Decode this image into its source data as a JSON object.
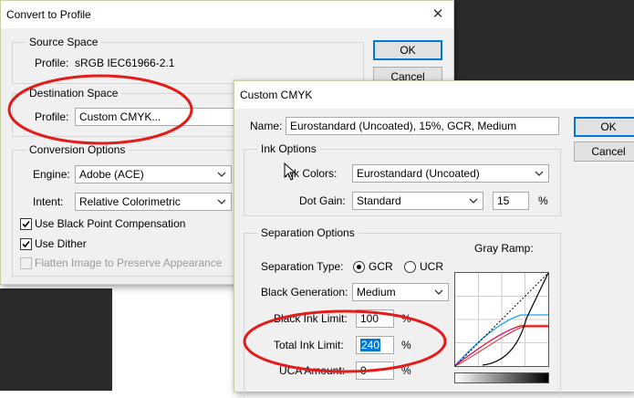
{
  "convert": {
    "title": "Convert to Profile",
    "close": "✕",
    "source_space": {
      "legend": "Source Space",
      "profile_label": "Profile:",
      "profile_value": "sRGB IEC61966-2.1"
    },
    "destination_space": {
      "legend": "Destination Space",
      "profile_label": "Profile:",
      "profile_value": "Custom CMYK..."
    },
    "conversion_options": {
      "legend": "Conversion Options",
      "engine_label": "Engine:",
      "engine_value": "Adobe (ACE)",
      "intent_label": "Intent:",
      "intent_value": "Relative Colorimetric",
      "black_point": {
        "label": "Use Black Point Compensation",
        "checked": true
      },
      "dither": {
        "label": "Use Dither",
        "checked": true
      },
      "flatten": {
        "label": "Flatten Image to Preserve Appearance",
        "checked": false,
        "disabled": true
      }
    },
    "ok": "OK",
    "cancel": "Cancel"
  },
  "custom_cmyk": {
    "title": "Custom CMYK",
    "name_label": "Name:",
    "name_value": "Eurostandard (Uncoated), 15%, GCR, Medium",
    "ok": "OK",
    "cancel": "Cancel",
    "ink_options": {
      "legend": "Ink Options",
      "ink_colors_label": "Ink Colors:",
      "ink_colors_value": "Eurostandard (Uncoated)",
      "dot_gain_label": "Dot Gain:",
      "dot_gain_mode": "Standard",
      "dot_gain_value": "15",
      "dot_gain_unit": "%"
    },
    "separation_options": {
      "legend": "Separation Options",
      "type_label": "Separation Type:",
      "gcr": "GCR",
      "ucr": "UCR",
      "selected": "GCR",
      "black_generation_label": "Black Generation:",
      "black_generation_value": "Medium",
      "black_ink_limit_label": "Black Ink Limit:",
      "black_ink_limit_value": "100",
      "total_ink_limit_label": "Total Ink Limit:",
      "total_ink_limit_value": "240",
      "uca_amount_label": "UCA Amount:",
      "uca_amount_value": "0",
      "percent": "%",
      "gray_ramp_label": "Gray Ramp:"
    }
  },
  "colors": {
    "annotation": "#e41b1b",
    "accent": "#0078d7",
    "cyan": "#1aa3e8",
    "magenta": "#e8007a",
    "yellow": "#ffd400"
  }
}
